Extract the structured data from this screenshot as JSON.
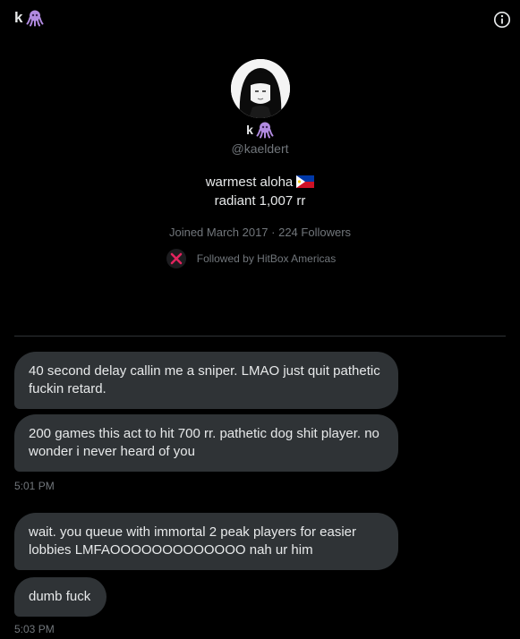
{
  "header": {
    "name": "k",
    "emoji_icon": "octopus-icon",
    "info_icon": "info-icon"
  },
  "profile": {
    "name": "k",
    "handle": "@kaeldert",
    "bio_line1": "warmest aloha",
    "bio_flag_icon": "philippines-flag-icon",
    "bio_line2": "radiant 1,007 rr",
    "joined": "Joined March 2017 · 224 Followers",
    "followed_by": "Followed by HitBox Americas"
  },
  "messages": [
    {
      "text": "40 second delay callin me a sniper. LMAO just quit pathetic fuckin retard."
    },
    {
      "text": "200 games this act to hit 700 rr. pathetic dog shit player. no wonder i never heard of you"
    },
    {
      "text": "wait. you queue with immortal 2 peak players for easier lobbies LMFAOOOOOOOOOOOOO nah ur him"
    },
    {
      "text": "dumb fuck"
    }
  ],
  "timestamps": [
    "5:01 PM",
    "5:03 PM"
  ],
  "colors": {
    "background": "#000000",
    "bubble": "#2f3336",
    "text": "#e7e9ea",
    "secondary_text": "#71767b",
    "octopus": "#b18ae0"
  }
}
